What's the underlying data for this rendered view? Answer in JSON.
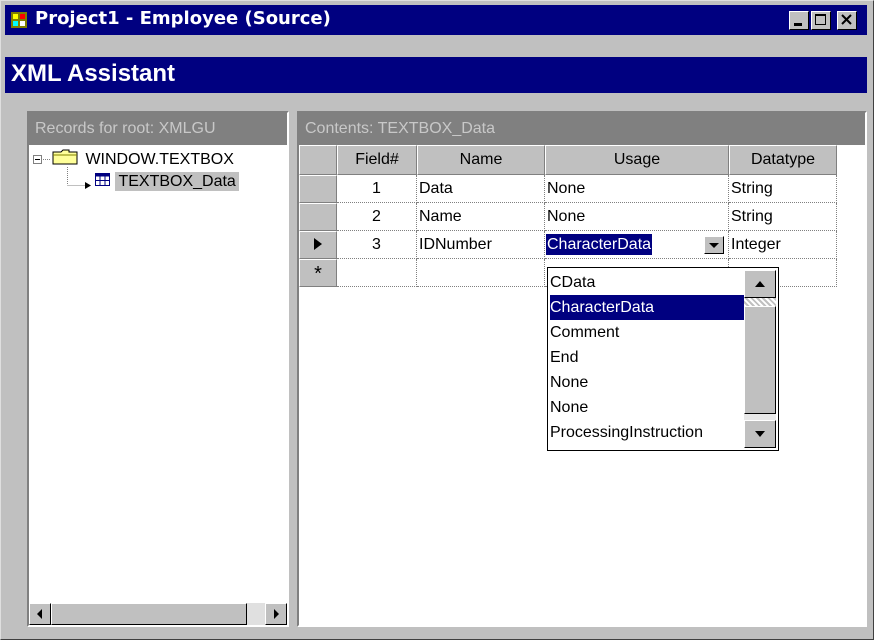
{
  "window": {
    "title": "Project1 - Employee (Source)",
    "app_icon": "xml-project-icon",
    "minimize_icon": "minimize-icon",
    "maximize_icon": "maximize-icon",
    "close_icon": "close-icon"
  },
  "header": {
    "title": "XML Assistant"
  },
  "left_pane": {
    "caption": "Records for root: XMLGU",
    "tree": [
      {
        "label": "WINDOW.TEXTBOX",
        "icon": "folder-icon"
      },
      {
        "label": "TEXTBOX_Data",
        "icon": "table-icon"
      }
    ]
  },
  "right_pane": {
    "caption": "Contents: TEXTBOX_Data",
    "columns": [
      "Field#",
      "Name",
      "Usage",
      "Datatype"
    ],
    "rows": [
      {
        "field": "1",
        "name": "Data",
        "usage": "None",
        "datatype": "String"
      },
      {
        "field": "2",
        "name": "Name",
        "usage": "None",
        "datatype": "String"
      },
      {
        "field": "3",
        "name": "IDNumber",
        "usage": "CharacterData",
        "datatype": "Integer"
      }
    ],
    "new_row_marker": "*",
    "current_row_marker": "▶"
  },
  "usage_dropdown": {
    "selected": "CharacterData",
    "options": [
      "CData",
      "CharacterData",
      "Comment",
      "End",
      "None",
      "None",
      "ProcessingInstruction"
    ]
  },
  "colors": {
    "titlebar": "#000080",
    "selection": "#000080",
    "face": "#c0c0c0"
  }
}
